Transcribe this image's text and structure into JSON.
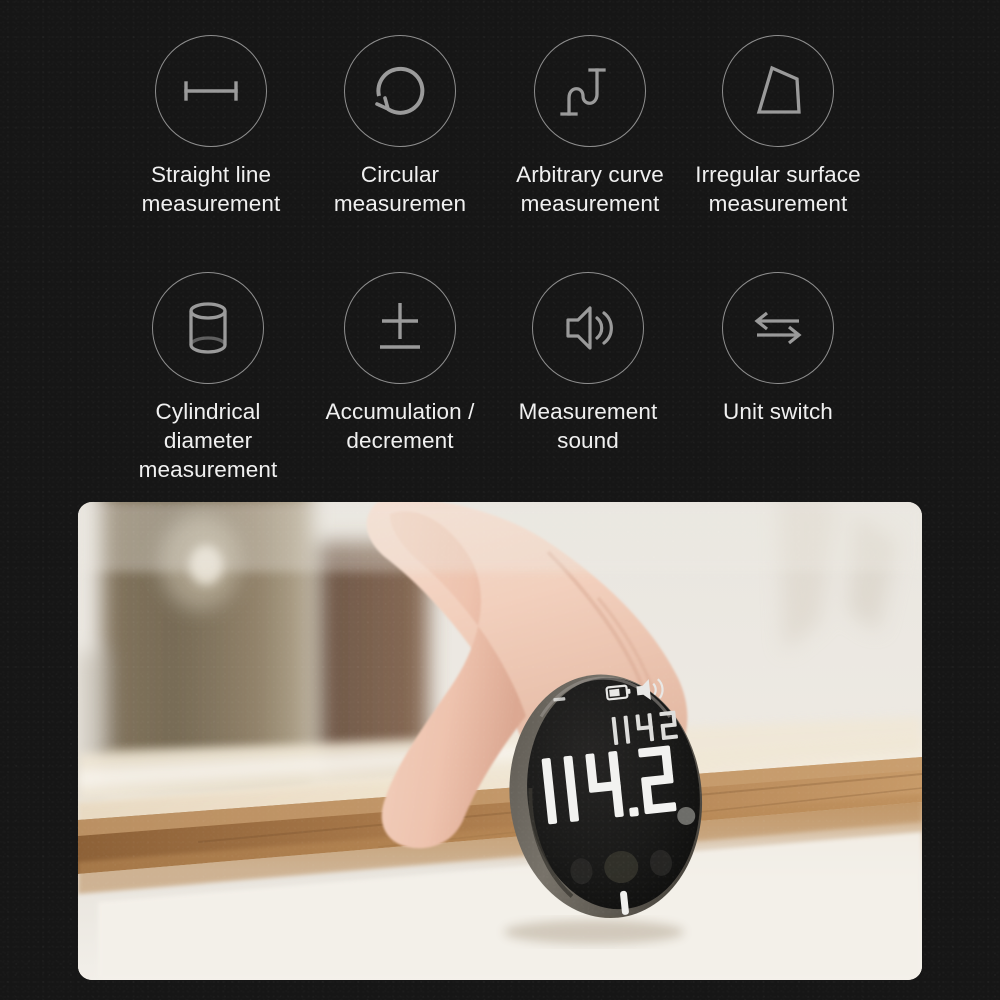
{
  "page": {
    "background_color": "#161616",
    "text_color": "#f0f0f0",
    "icon_stroke_color": "#8e8e8e"
  },
  "features": {
    "row1": [
      {
        "icon": "straight-line-icon",
        "label": "Straight line\nmeasurement"
      },
      {
        "icon": "circular-arrow-icon",
        "label": "Circular\nmeasuremen"
      },
      {
        "icon": "arbitrary-curve-icon",
        "label": "Arbitrary curve\nmeasurement"
      },
      {
        "icon": "irregular-surface-icon",
        "label": "Irregular surface\nmeasurement"
      }
    ],
    "row2": [
      {
        "icon": "cylinder-icon",
        "label": "Cylindrical\ndiameter\nmeasurement"
      },
      {
        "icon": "plus-minus-icon",
        "label": "Accumulation /\ndecrement"
      },
      {
        "icon": "speaker-sound-icon",
        "label": "Measurement\nsound"
      },
      {
        "icon": "unit-switch-arrows-icon",
        "label": "Unit switch"
      }
    ]
  },
  "photo": {
    "name": "product-in-hand-photo",
    "scene_description": "A hand holding a small round laser distance measuring device against a wooden table edge",
    "device_display": {
      "main_value": "114.2",
      "secondary_value": "114.2",
      "battery_icon": "battery-icon",
      "sound_icon": "sound-on-icon",
      "unit_dot": "decimal-point"
    }
  }
}
